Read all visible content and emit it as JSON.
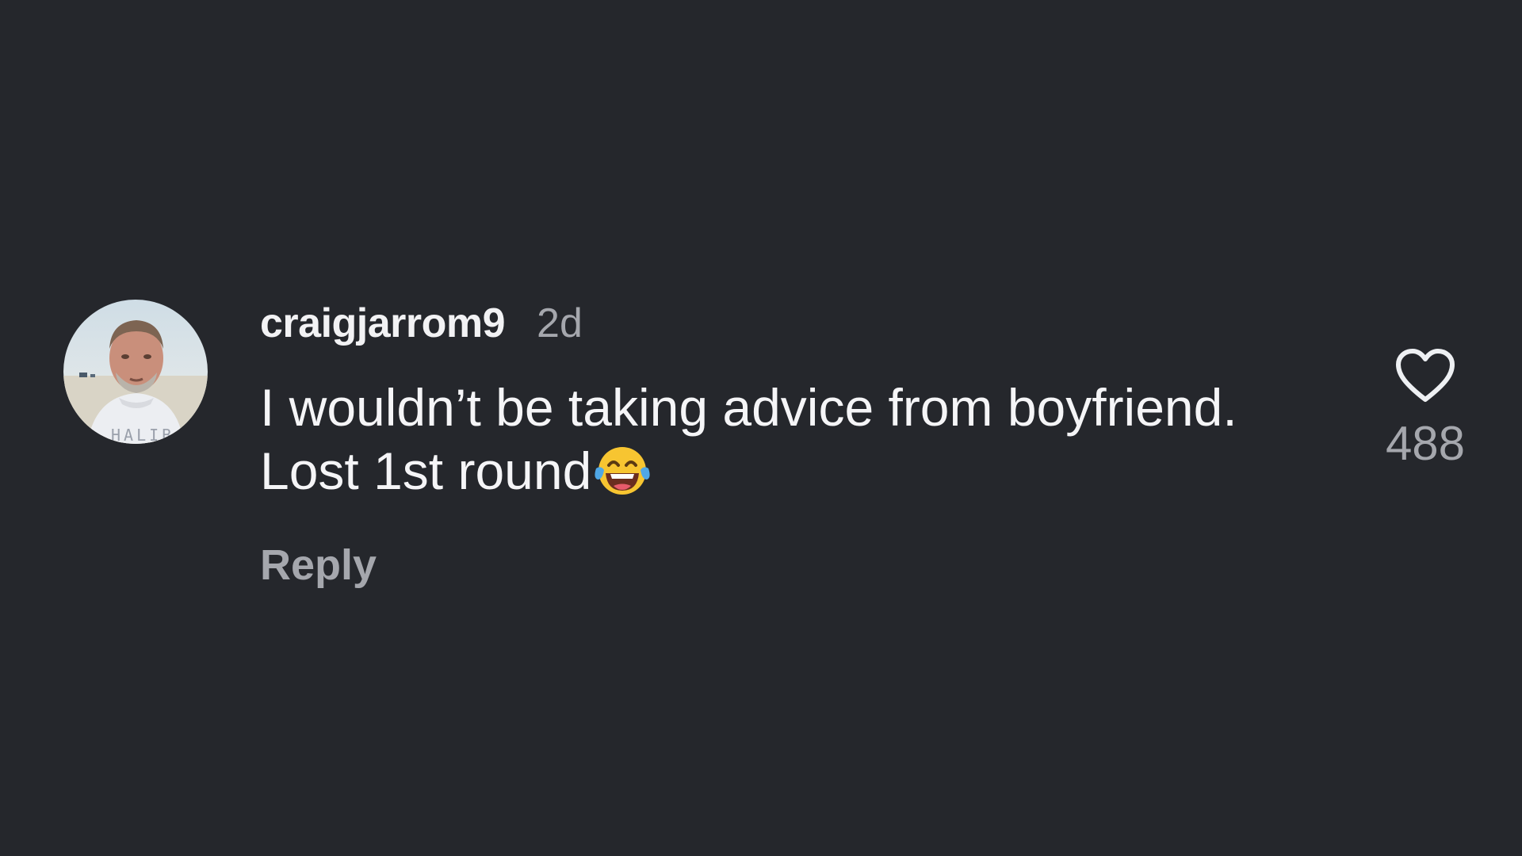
{
  "comment": {
    "username": "craigjarrom9",
    "timestamp": "2d",
    "text_line1": "I wouldn’t be taking advice from boyfriend.",
    "text_line2": "Lost 1st round",
    "emoji": "face-with-tears-of-joy",
    "reply_label": "Reply",
    "like_count": "488",
    "like_icon": "heart-outline-icon"
  },
  "colors": {
    "background": "#25272c",
    "username": "#f2f2f4",
    "secondary_text": "#a5a7ad",
    "body_text": "#f5f5f7"
  }
}
